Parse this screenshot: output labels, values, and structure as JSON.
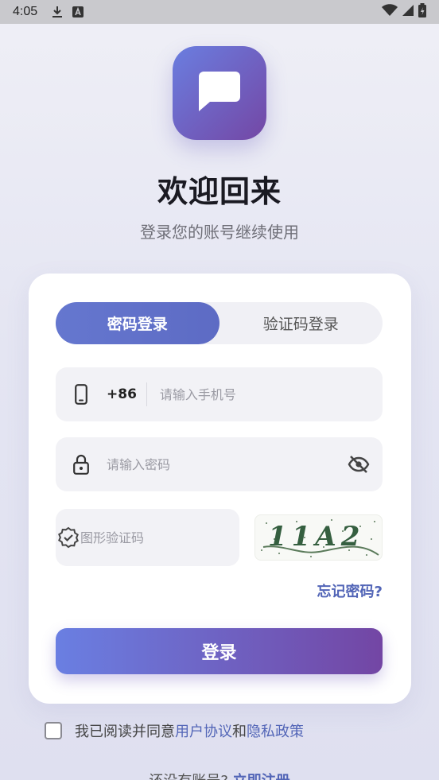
{
  "status_bar": {
    "time": "4:05",
    "icons": [
      "download-icon",
      "a-badge-icon",
      "wifi-icon",
      "signal-icon",
      "battery-icon"
    ]
  },
  "header": {
    "logo_icon": "chat-bubble-icon",
    "title": "欢迎回来",
    "subtitle": "登录您的账号继续使用"
  },
  "tabs": [
    {
      "label": "密码登录",
      "active": true
    },
    {
      "label": "验证码登录",
      "active": false
    }
  ],
  "phone": {
    "icon": "phone-icon",
    "prefix": "+86",
    "placeholder": "请输入手机号",
    "value": ""
  },
  "password": {
    "icon": "lock-icon",
    "placeholder": "请输入密码",
    "value": "",
    "toggle_icon": "eye-off-icon"
  },
  "captcha": {
    "icon": "verified-badge-icon",
    "placeholder": "图形验证码",
    "value": "",
    "image_text": "11A2"
  },
  "forgot_label": "忘记密码?",
  "login_label": "登录",
  "agreement": {
    "prefix": "我已阅读并同意",
    "terms": "用户协议",
    "and": "和",
    "privacy": "隐私政策",
    "checked": false
  },
  "register": {
    "question": "还没有账号?",
    "link": "立即注册"
  },
  "colors": {
    "accent": "#5d6bc4",
    "gradient_start": "#6a7fe2",
    "gradient_end": "#7346a4",
    "link": "#5265b7"
  }
}
